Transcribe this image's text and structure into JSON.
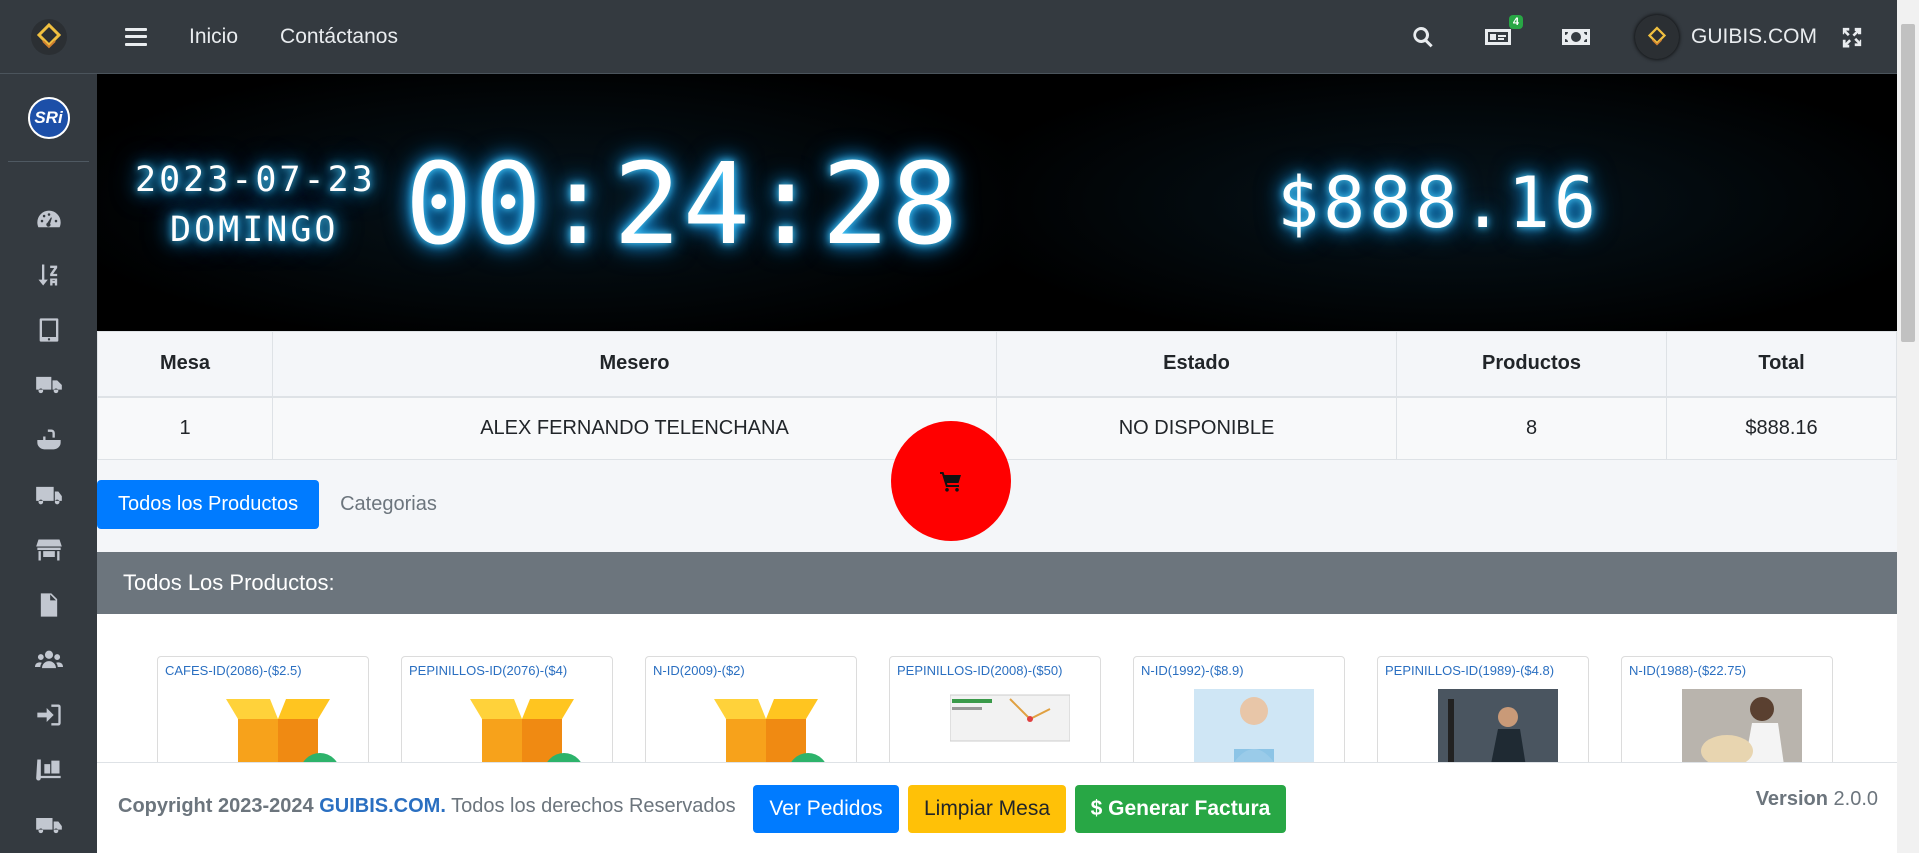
{
  "topbar": {
    "nav": [
      "Inicio",
      "Contáctanos"
    ],
    "notif_count": "4",
    "user_name": "GUIBIS.COM"
  },
  "sidebar": {
    "sri_label": "SRi",
    "icons": [
      "tachometer-icon",
      "sort-amount-icon",
      "tablet-icon",
      "truck-icon",
      "sink-icon",
      "truck-moving-icon",
      "store-icon",
      "pdf-file-icon",
      "users-icon",
      "sign-in-icon",
      "dolly-icon",
      "shipping-icon"
    ]
  },
  "clock": {
    "date": "2023-07-23",
    "day": "DOMINGO",
    "time": "00:24:28",
    "amount": "$888.16"
  },
  "table": {
    "headers": [
      "Mesa",
      "Mesero",
      "Estado",
      "Productos",
      "Total"
    ],
    "row": [
      "1",
      "ALEX FERNANDO TELENCHANA",
      "NO DISPONIBLE",
      "8",
      "$888.16"
    ]
  },
  "tabs": {
    "all": "Todos los Productos",
    "categories": "Categorias"
  },
  "products": {
    "header": "Todos Los Productos:",
    "items": [
      {
        "title": "CAFES-ID(2086)-($2.5)",
        "image": "box-icon"
      },
      {
        "title": "PEPINILLOS-ID(2076)-($4)",
        "image": "box-icon"
      },
      {
        "title": "N-ID(2009)-($2)",
        "image": "box-icon"
      },
      {
        "title": "PEPINILLOS-ID(2008)-($50)",
        "image": "map-screenshot"
      },
      {
        "title": "N-ID(1992)-($8.9)",
        "image": "doctor-photo"
      },
      {
        "title": "PEPINILLOS-ID(1989)-($4.8)",
        "image": "gym-photo"
      },
      {
        "title": "N-ID(1988)-($22.75)",
        "image": "vet-photo"
      }
    ]
  },
  "footer": {
    "copyright_prefix": "Copyright 2023-2024",
    "brand": "GUIBIS.COM.",
    "rights": "Todos los derechos Reservados",
    "btn_orders": "Ver Pedidos",
    "btn_clear": "Limpiar Mesa",
    "btn_invoice": "$ Generar Factura",
    "version_label": "Version",
    "version_value": "2.0.0"
  },
  "colors": {
    "sidebar_bg": "#343a40",
    "primary": "#007bff",
    "warning": "#ffc107",
    "success": "#28a745",
    "fab": "#ff0000"
  }
}
